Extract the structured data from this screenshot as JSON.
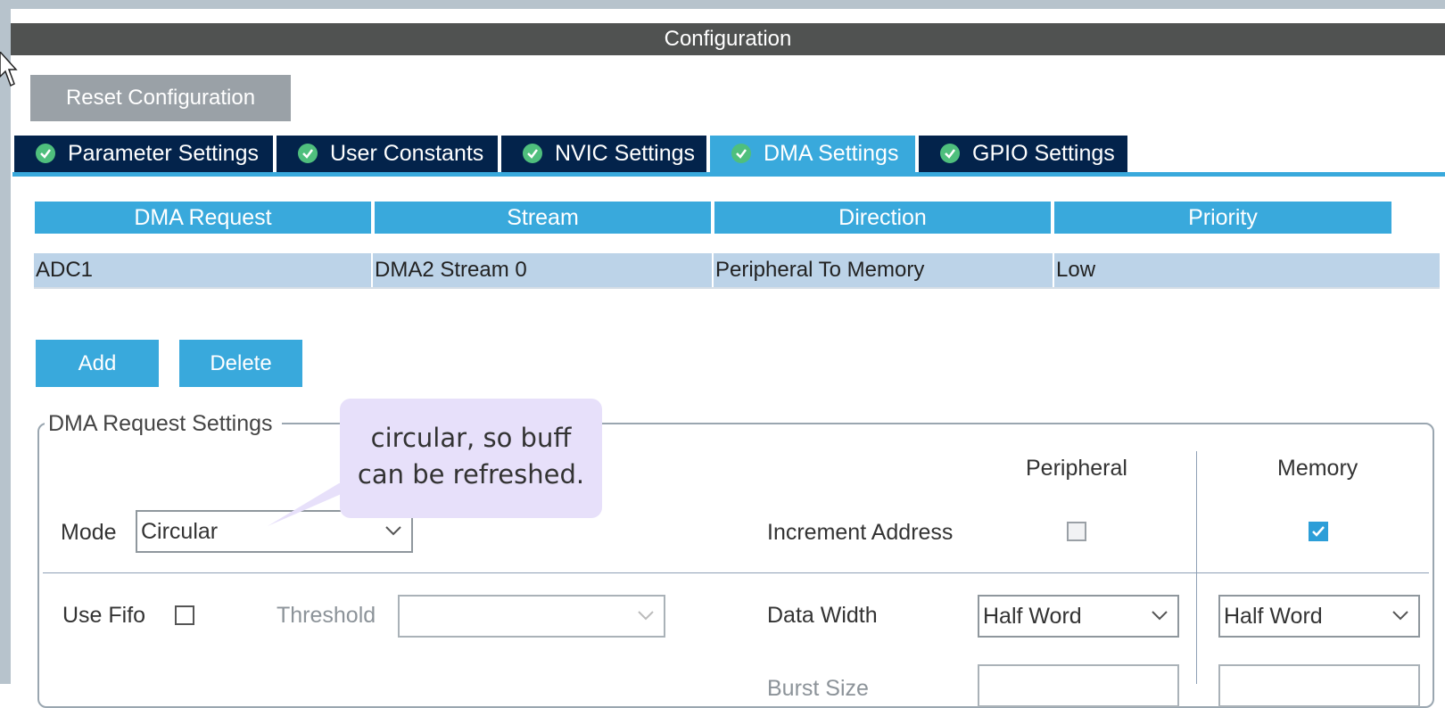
{
  "window": {
    "title": "Configuration"
  },
  "toolbar": {
    "reset_label": "Reset Configuration"
  },
  "tabs": [
    {
      "label": "Parameter Settings",
      "active": false
    },
    {
      "label": "User Constants",
      "active": false
    },
    {
      "label": "NVIC Settings",
      "active": false
    },
    {
      "label": "DMA Settings",
      "active": true
    },
    {
      "label": "GPIO Settings",
      "active": false
    }
  ],
  "dma_table": {
    "columns": [
      "DMA Request",
      "Stream",
      "Direction",
      "Priority"
    ],
    "rows": [
      [
        "ADC1",
        "DMA2 Stream 0",
        "Peripheral To Memory",
        "Low"
      ]
    ]
  },
  "actions": {
    "add_label": "Add",
    "delete_label": "Delete"
  },
  "request_settings": {
    "legend": "DMA Request Settings",
    "mode_label": "Mode",
    "mode_value": "Circular",
    "use_fifo_label": "Use Fifo",
    "use_fifo_checked": false,
    "threshold_label": "Threshold",
    "threshold_value": "",
    "peripheral_header": "Peripheral",
    "memory_header": "Memory",
    "increment_label": "Increment Address",
    "increment_peripheral": false,
    "increment_memory": true,
    "data_width_label": "Data Width",
    "data_width_peripheral": "Half Word",
    "data_width_memory": "Half Word",
    "burst_label": "Burst Size"
  },
  "annotation": {
    "line1": "circular, so buff",
    "line2": "can be refreshed."
  },
  "colors": {
    "accent": "#39a9dc",
    "tab_dark": "#03234b",
    "title_bar": "#505251",
    "row_selected": "#bcd3e8",
    "check_green": "#4fbf7d",
    "callout": "#e7e0fa"
  }
}
